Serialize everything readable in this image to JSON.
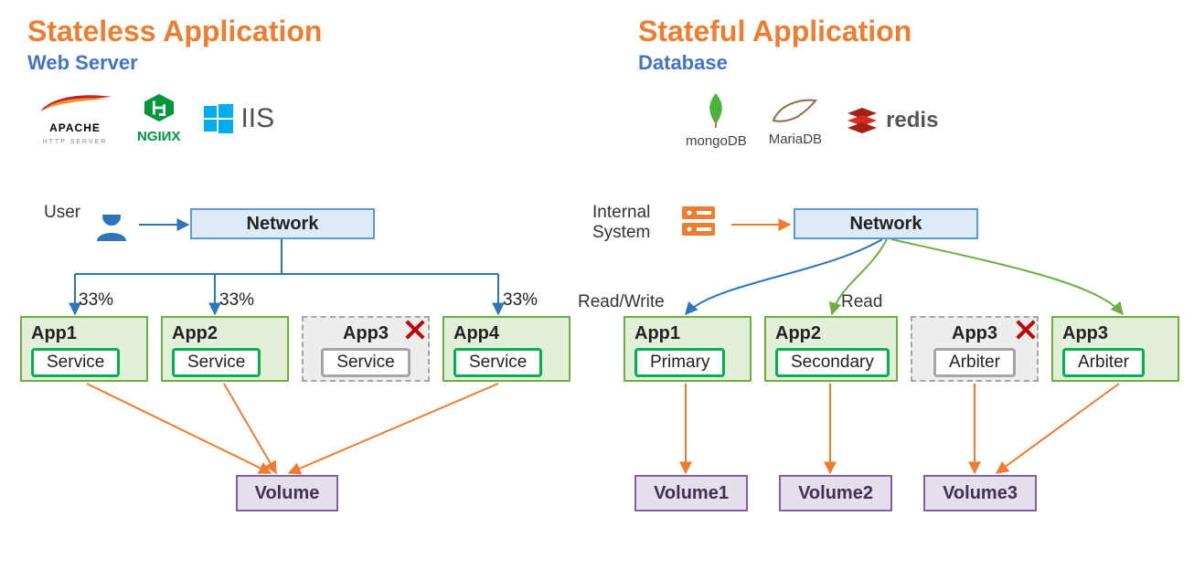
{
  "left": {
    "main_title": "Stateless Application",
    "sub_title": "Web Server",
    "logos": {
      "apache_top": "APACHE",
      "apache_sub": "HTTP SERVER",
      "nginx": "NGIИX",
      "iis": "IIS"
    },
    "user_label": "User",
    "network_label": "Network",
    "pct1": "33%",
    "pct2": "33%",
    "pct3": "33%",
    "apps": {
      "a1": {
        "title": "App1",
        "role": "Service"
      },
      "a2": {
        "title": "App2",
        "role": "Service"
      },
      "a3": {
        "title": "App3",
        "role": "Service"
      },
      "a4": {
        "title": "App4",
        "role": "Service"
      }
    },
    "volume_label": "Volume"
  },
  "right": {
    "main_title": "Stateful Application",
    "sub_title": "Database",
    "logos": {
      "mongo": "mongoDB",
      "maria": "MariaDB",
      "redis": "redis"
    },
    "internal_line1": "Internal",
    "internal_line2": "System",
    "network_label": "Network",
    "rw_label": "Read/Write",
    "r_label": "Read",
    "apps": {
      "a1": {
        "title": "App1",
        "role": "Primary"
      },
      "a2": {
        "title": "App2",
        "role": "Secondary"
      },
      "a3": {
        "title": "App3",
        "role": "Arbiter"
      },
      "a3b": {
        "title": "App3",
        "role": "Arbiter"
      }
    },
    "volumes": {
      "v1": "Volume1",
      "v2": "Volume2",
      "v3": "Volume3"
    }
  }
}
